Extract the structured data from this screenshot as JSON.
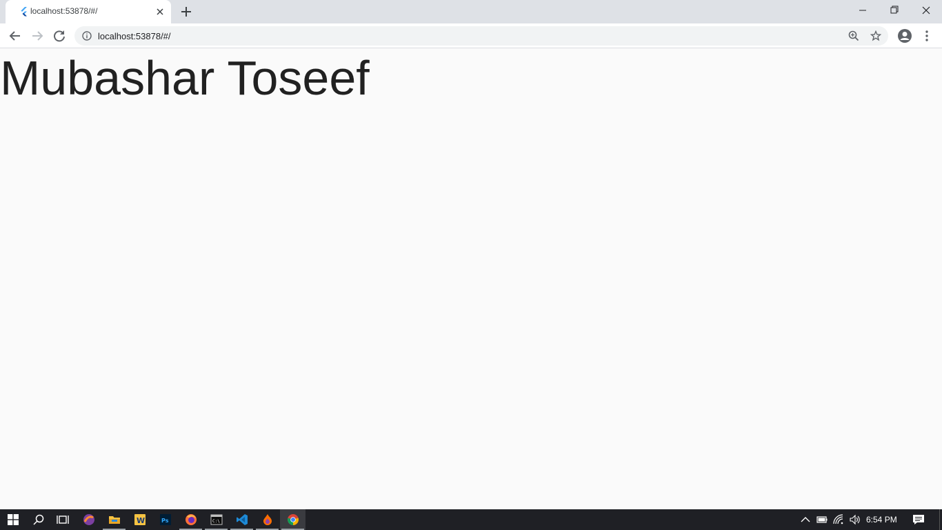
{
  "tab": {
    "title": "localhost:53878/#/"
  },
  "omnibox": {
    "url": "localhost:53878/#/"
  },
  "page": {
    "heading": "Mubashar Toseef"
  },
  "taskbar": {
    "clock": "6:54 PM"
  },
  "colors": {
    "tabstrip": "#dee1e6",
    "taskbar": "#1f2025",
    "page_bg": "#fafafa",
    "heading": "#212121"
  },
  "icons": [
    "flutter-favicon",
    "close-icon",
    "plus-icon",
    "minimize-icon",
    "restore-icon",
    "close-window-icon",
    "back-icon",
    "forward-icon",
    "reload-icon",
    "info-icon",
    "zoom-icon",
    "star-icon",
    "profile-icon",
    "menu-icon",
    "windows-start-icon",
    "search-icon",
    "task-view-icon"
  ]
}
